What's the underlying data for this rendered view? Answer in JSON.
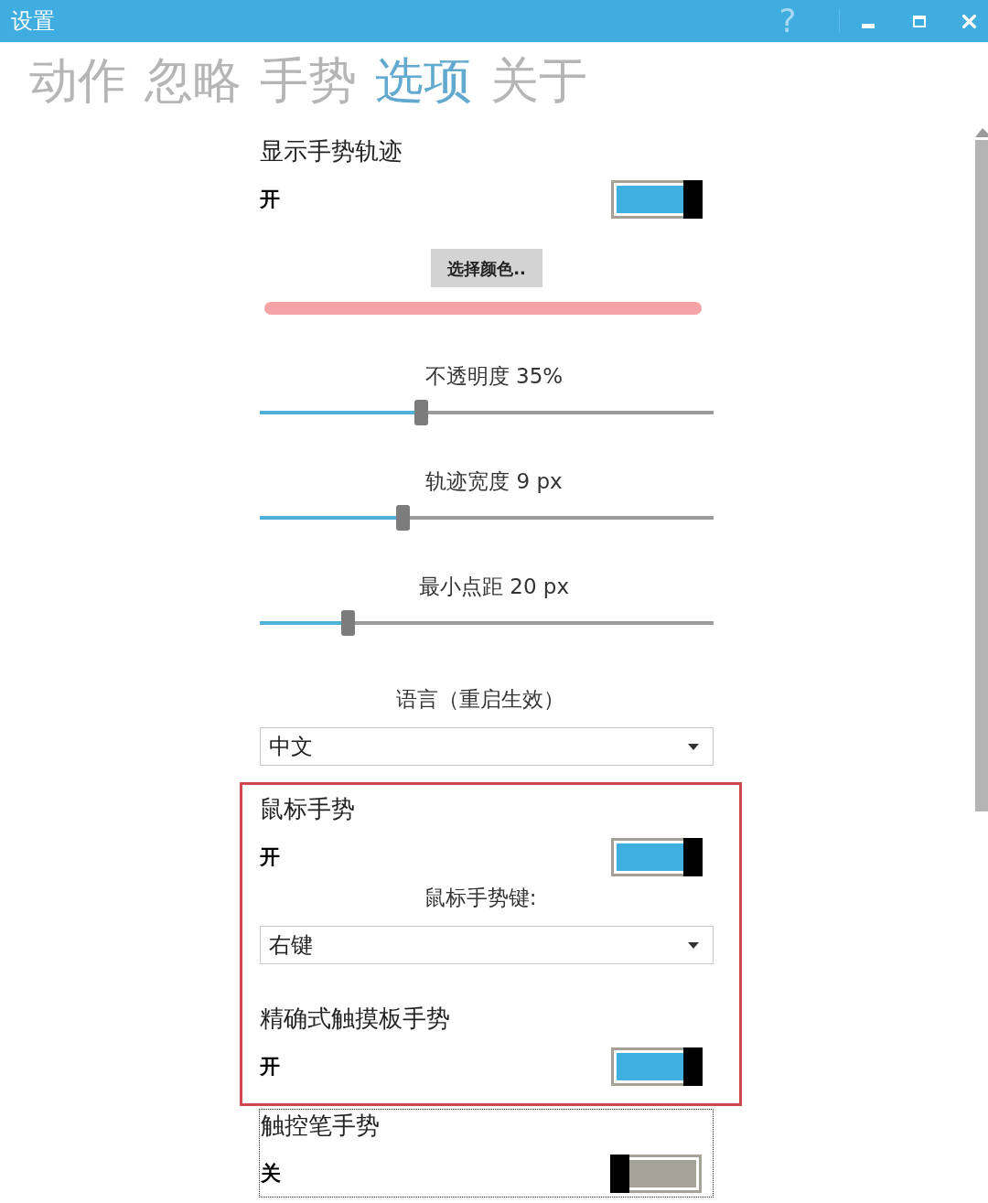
{
  "window": {
    "title": "设置",
    "help": "?"
  },
  "tabs": [
    {
      "label": "动作",
      "selected": false
    },
    {
      "label": "忽略",
      "selected": false
    },
    {
      "label": "手势",
      "selected": false
    },
    {
      "label": "选项",
      "selected": true
    },
    {
      "label": "关于",
      "selected": false
    }
  ],
  "settings": [
    {
      "kind": "toggle",
      "title": "显示手势轨迹",
      "state_label": "开",
      "on": true
    },
    {
      "kind": "button",
      "label": "选择颜色.."
    },
    {
      "kind": "color_bar",
      "color": "#f5a3a5"
    },
    {
      "kind": "slider",
      "label": "不透明度 35%",
      "level": 0.35
    },
    {
      "kind": "slider",
      "label": "轨迹宽度 9 px",
      "level": 0.31
    },
    {
      "kind": "slider",
      "label": "最小点距 20 px",
      "level": 0.19
    },
    {
      "kind": "dropdown",
      "label": "语言（重启生效）",
      "value": "中文"
    },
    {
      "kind": "highlight_group",
      "items": [
        {
          "kind": "toggle",
          "title": "鼠标手势",
          "state_label": "开",
          "on": true
        },
        {
          "kind": "dropdown",
          "label": "鼠标手势键:",
          "value": "右键"
        },
        {
          "kind": "toggle",
          "title": "精确式触摸板手势",
          "state_label": "开",
          "on": true
        }
      ]
    },
    {
      "kind": "focus_group",
      "items": [
        {
          "kind": "toggle",
          "title": "触控笔手势",
          "state_label": "关",
          "on": false
        }
      ]
    }
  ]
}
